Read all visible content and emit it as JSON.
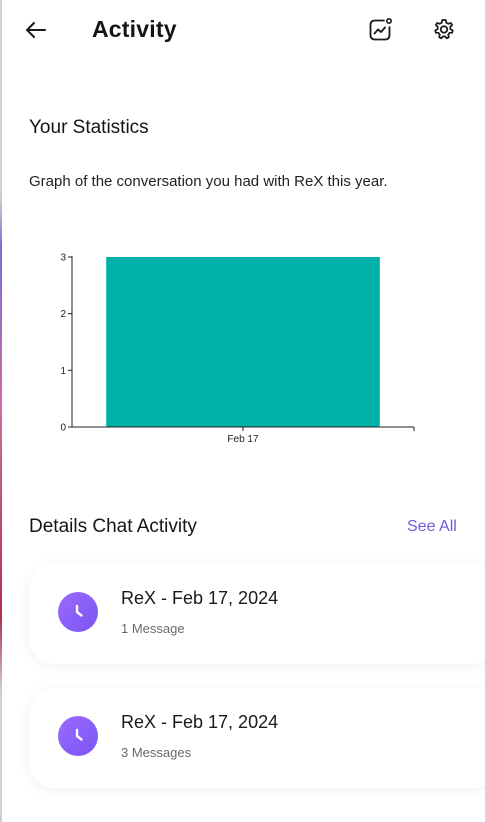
{
  "header": {
    "title": "Activity",
    "back_icon": "arrow-left-icon",
    "stats_icon": "chart-trend-icon",
    "settings_icon": "gear-icon"
  },
  "stats": {
    "title": "Your Statistics",
    "description": "Graph of the conversation you had with ReX this year."
  },
  "chart_data": {
    "type": "bar",
    "categories": [
      "Feb 17"
    ],
    "values": [
      3
    ],
    "ylim": [
      0,
      3
    ],
    "yticks": [
      0,
      1,
      2,
      3
    ],
    "bar_color": "#00b1aa",
    "grid": false
  },
  "details": {
    "title": "Details Chat Activity",
    "see_all": "See All",
    "items": [
      {
        "title": "ReX - Feb 17, 2024",
        "subtitle": "1 Message",
        "icon": "clock-icon"
      },
      {
        "title": "ReX - Feb 17, 2024",
        "subtitle": "3 Messages",
        "icon": "clock-icon"
      }
    ]
  },
  "colors": {
    "accent": "#6b5ce0",
    "clock_gradient_start": "#9c6bff",
    "clock_gradient_end": "#7a54f3"
  }
}
